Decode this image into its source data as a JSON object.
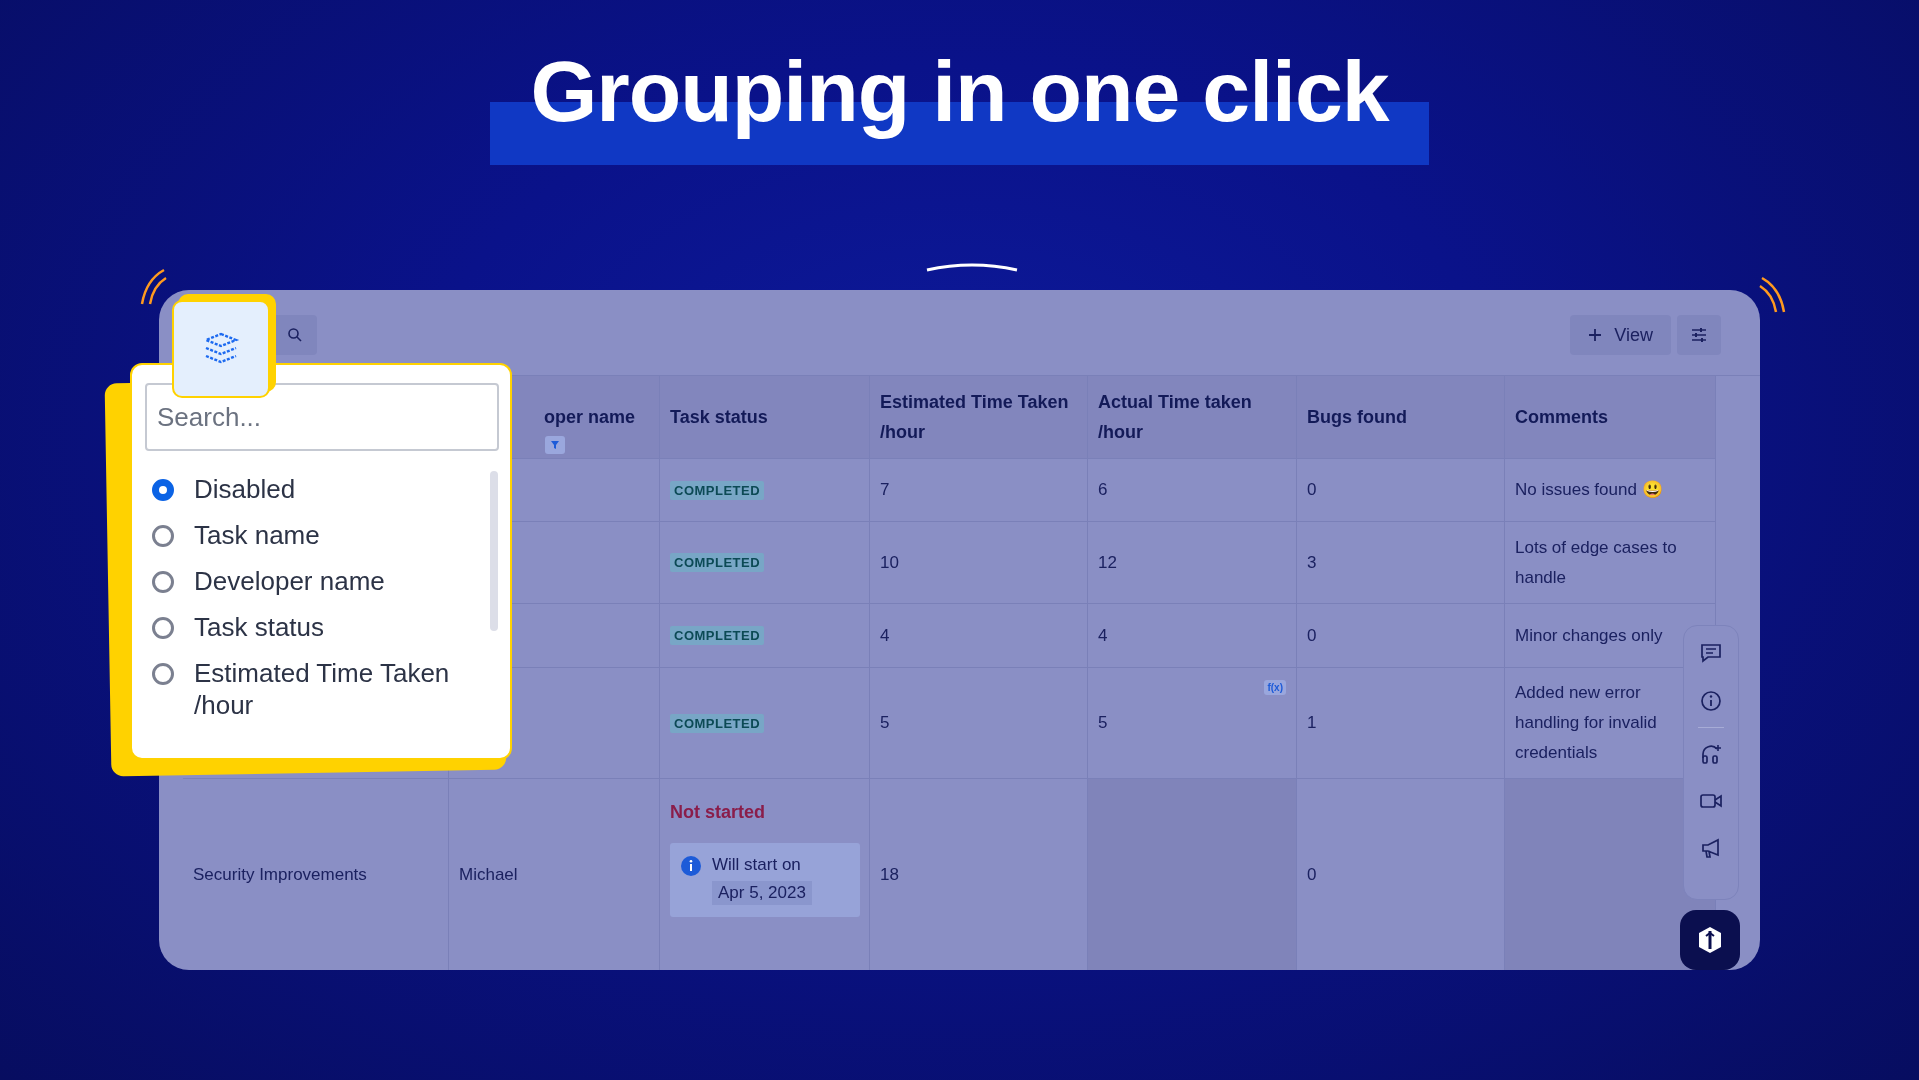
{
  "title": "Grouping in one click",
  "toolbar": {
    "view_button": "View"
  },
  "group_menu": {
    "search": {
      "placeholder": "Search..."
    },
    "options": [
      {
        "label": "Disabled",
        "selected": true
      },
      {
        "label": "Task name",
        "selected": false
      },
      {
        "label": "Developer name",
        "selected": false
      },
      {
        "label": "Task status",
        "selected": false
      },
      {
        "label": "Estimated Time Taken /hour",
        "selected": false
      }
    ]
  },
  "table": {
    "columns": [
      {},
      {
        "label": "oper name",
        "filter": true
      },
      {
        "label": "Task status"
      },
      {
        "label": "Estimated Time Taken /hour"
      },
      {
        "label": "Actual Time taken /hour"
      },
      {
        "label": "Bugs found"
      },
      {
        "label": "Comments"
      }
    ],
    "rows": [
      {
        "status": {
          "kind": "badge",
          "text": "COMPLETED"
        },
        "estimated": "7",
        "actual": "6",
        "bugs": "0",
        "comment": "No issues found 😃"
      },
      {
        "status": {
          "kind": "badge",
          "text": "COMPLETED"
        },
        "estimated": "10",
        "actual": "12",
        "bugs": "3",
        "comment": "Lots of edge cases to handle"
      },
      {
        "status": {
          "kind": "badge",
          "text": "COMPLETED"
        },
        "estimated": "4",
        "actual": "4",
        "bugs": "0",
        "comment": "Minor changes only"
      },
      {
        "status": {
          "kind": "badge",
          "text": "COMPLETED"
        },
        "estimated": "5",
        "actual": "5",
        "formula": "f(x)",
        "bugs": "1",
        "comment": "Added new error handling for invalid credentials"
      },
      {
        "task_name": "Security Improvements",
        "developer": "Michael",
        "status": {
          "kind": "note",
          "text": "Not started",
          "note_lines": [
            "Will start on",
            "Apr 5, 2023"
          ]
        },
        "estimated": "18",
        "bugs": "0",
        "shaded": true
      }
    ]
  }
}
